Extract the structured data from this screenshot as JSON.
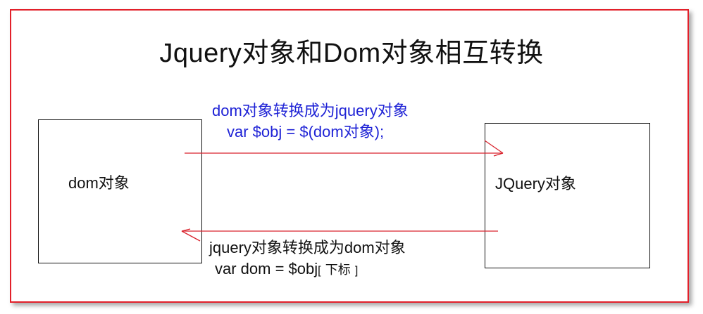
{
  "title": "Jquery对象和Dom对象相互转换",
  "boxes": {
    "dom": "dom对象",
    "jquery": "JQuery对象"
  },
  "dom_to_jquery": {
    "line1": "dom对象转换成为jquery对象",
    "line2": "var $obj = $(dom对象);"
  },
  "jquery_to_dom": {
    "line1": "jquery对象转换成为dom对象",
    "line2_code": "var dom = $obj",
    "line2_open": "[",
    "line2_index": "下标",
    "line2_close": "]"
  },
  "colors": {
    "frame": "#e2202a",
    "arrow": "#d9232d",
    "note_top": "#1f23d6",
    "text": "#111111"
  }
}
